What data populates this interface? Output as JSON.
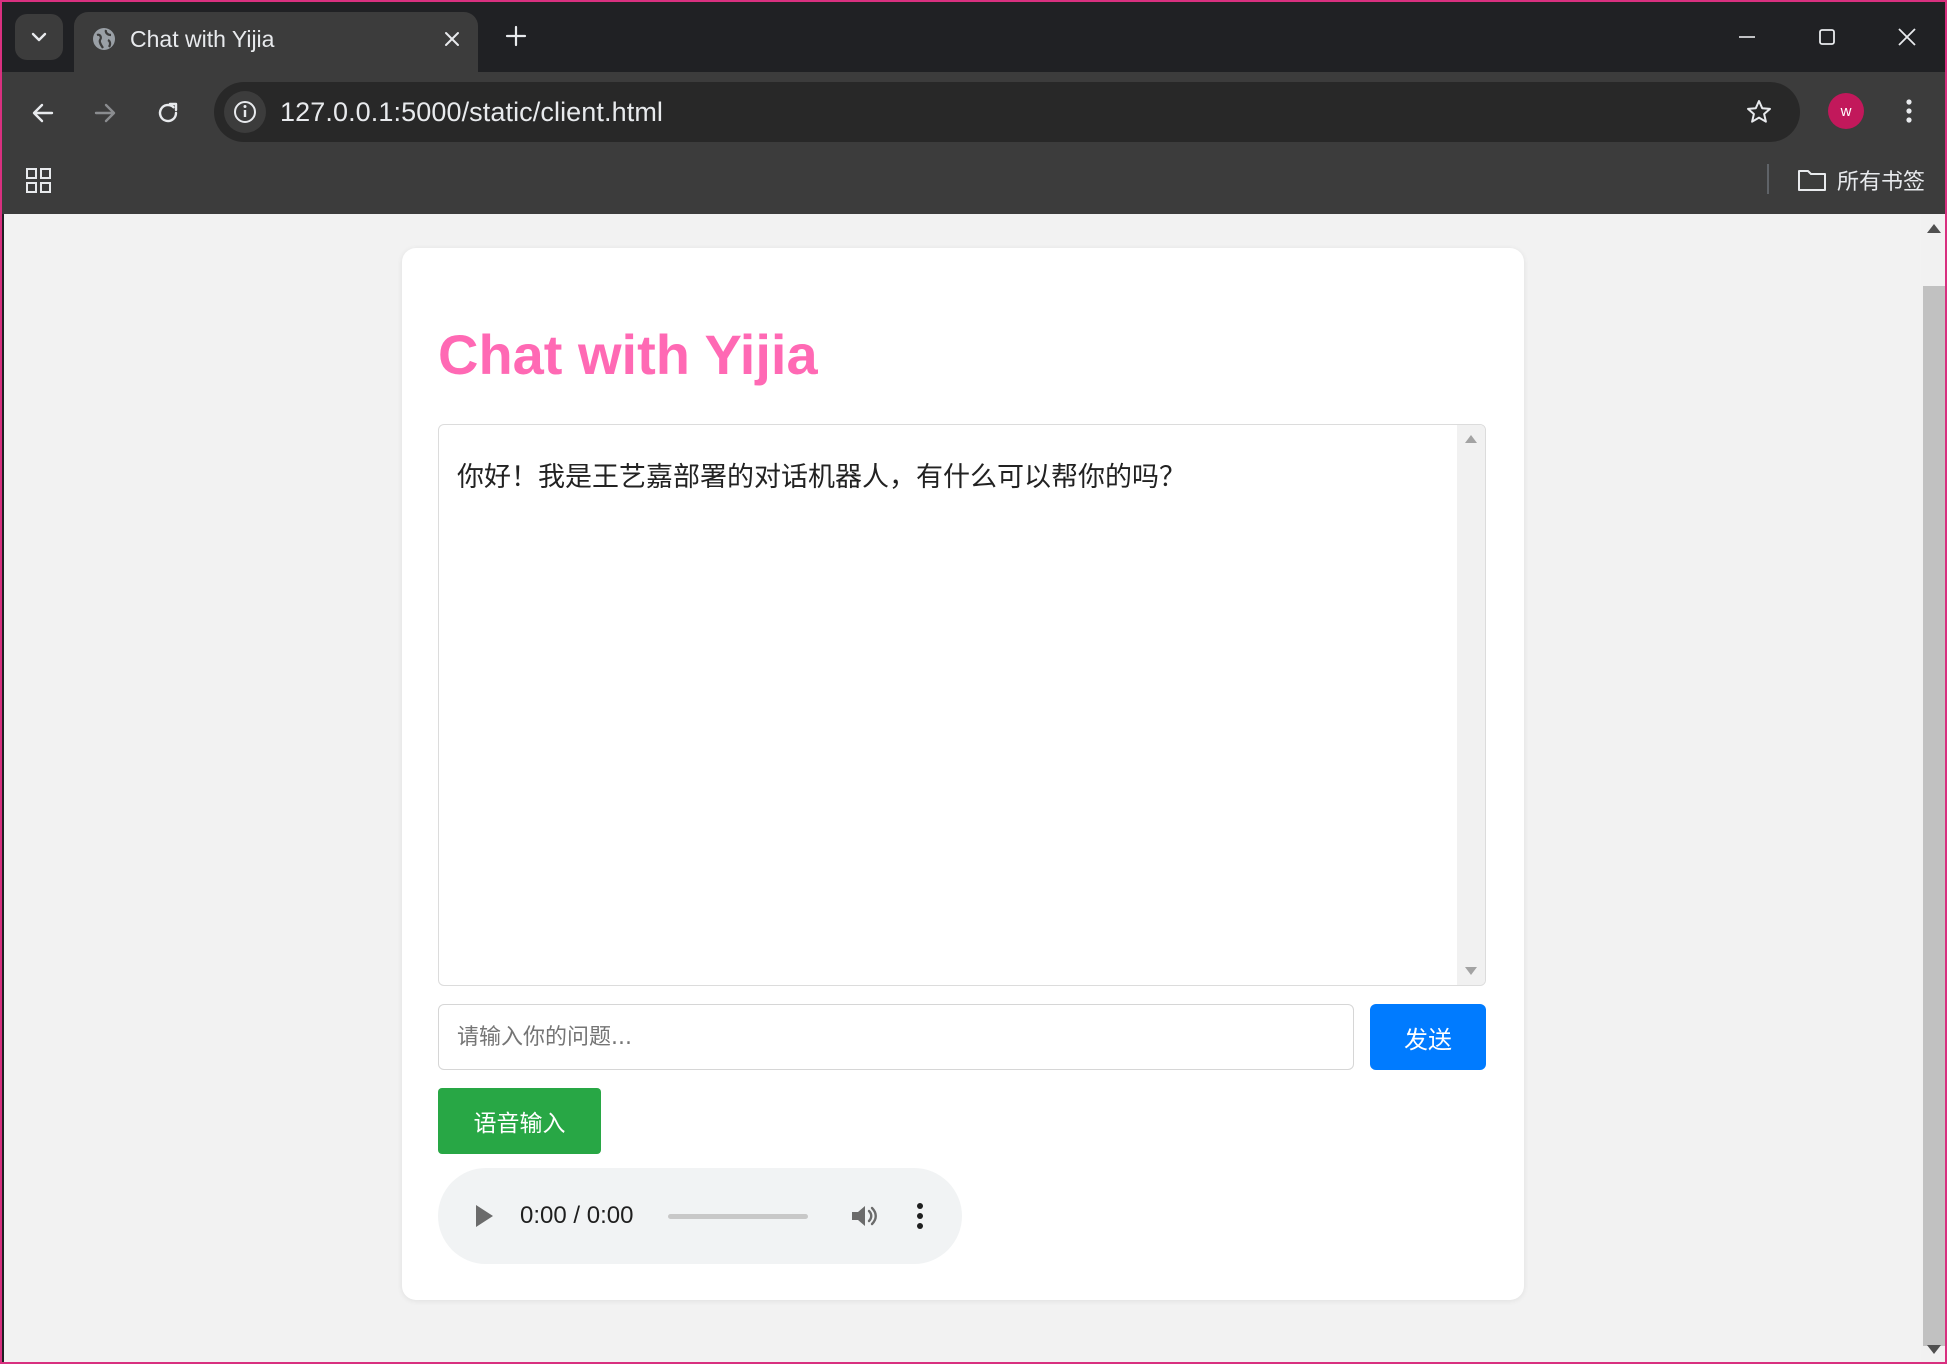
{
  "browser": {
    "tab_title": "Chat with Yijia",
    "url": "127.0.0.1:5000/static/client.html",
    "profile_initial": "w",
    "bookmarks_folder": "所有书签"
  },
  "page": {
    "heading": "Chat with Yijia",
    "heading_color": "#ff69b4",
    "messages": [
      {
        "text": "你好！我是王艺嘉部署的对话机器人，有什么可以帮你的吗？"
      }
    ],
    "input": {
      "value": "",
      "placeholder": "请输入你的问题..."
    },
    "send_button": "发送",
    "voice_button": "语音输入",
    "audio": {
      "time": "0:00 / 0:00"
    }
  },
  "icons": [
    "tab-search-icon",
    "globe-icon",
    "close-icon",
    "plus-icon",
    "minimize-icon",
    "maximize-icon",
    "back-icon",
    "forward-icon",
    "reload-icon",
    "info-icon",
    "star-icon",
    "more-vert-icon",
    "apps-icon",
    "folder-icon",
    "play-icon",
    "volume-icon"
  ]
}
